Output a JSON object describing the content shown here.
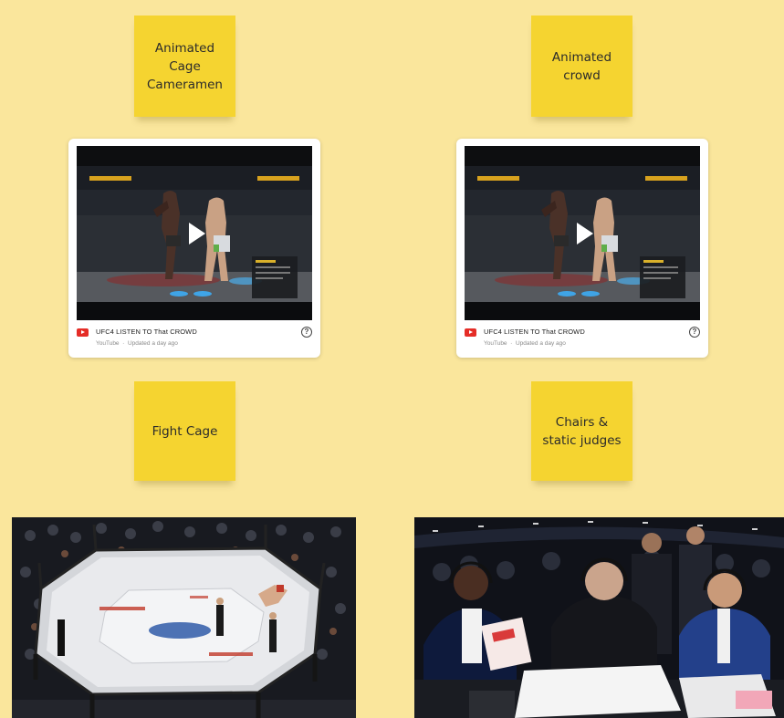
{
  "notes": [
    {
      "text": "Animated\nCage\nCameramen"
    },
    {
      "text": "Animated\ncrowd"
    },
    {
      "text": "Fight Cage"
    },
    {
      "text": "Chairs &\nstatic judges"
    }
  ],
  "videos": [
    {
      "title": "UFC4 LISTEN TO That CROWD",
      "source": "YouTube",
      "updated": "Updated a day ago",
      "play_icon": "play-icon",
      "help_icon": "question-mark-icon",
      "help_glyph": "?"
    },
    {
      "title": "UFC4 LISTEN TO That CROWD",
      "source": "YouTube",
      "updated": "Updated a day ago",
      "play_icon": "play-icon",
      "help_icon": "question-mark-icon",
      "help_glyph": "?"
    }
  ],
  "colors": {
    "board_background": "#fae69c",
    "sticky_note": "#f5d430",
    "youtube_red": "#e52d27",
    "card_background": "#ffffff"
  }
}
